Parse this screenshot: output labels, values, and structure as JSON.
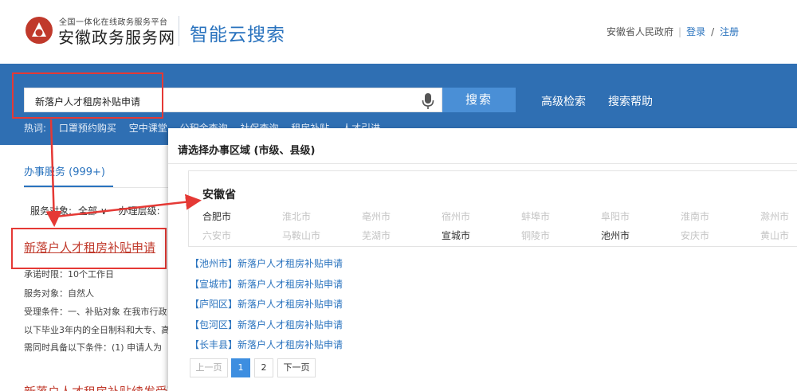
{
  "header": {
    "logo_small": "全国一体化在线政务服务平台",
    "logo_big": "安徽政务服务网",
    "site_title": "智能云搜索",
    "gov_link": "安徽省人民政府",
    "login": "登录",
    "slash": "/",
    "register": "注册"
  },
  "search": {
    "query": "新落户人才租房补贴申请",
    "button": "搜索",
    "advanced": "高级检索",
    "help": "搜索帮助"
  },
  "hotwords": {
    "label": "热词:",
    "items": [
      "口罩预约购买",
      "空中课堂",
      "公积金查询",
      "社保查询",
      "租房补贴",
      "人才引进"
    ]
  },
  "results": {
    "tab": "办事服务 (999+)",
    "filter_label": "服务对象:",
    "filter_value": "全部 ∨",
    "level_label": "办理层级:",
    "first_title": "新落户人才租房补贴申请",
    "info": [
      "承诺时限：10个工作日",
      "服务对象：自然人",
      "受理条件：一、补贴对象 在我市行政",
      "以下毕业3年内的全日制科和大专、高",
      "需同时具备以下条件：(1) 申请人为"
    ],
    "second_title": "新落户人才租房补贴续发受理"
  },
  "modal": {
    "title": "请选择办事区域 (市级、县级)",
    "province": "安徽省",
    "cities_row1": [
      {
        "name": "合肥市",
        "enabled": true
      },
      {
        "name": "淮北市",
        "enabled": false
      },
      {
        "name": "亳州市",
        "enabled": false
      },
      {
        "name": "宿州市",
        "enabled": false
      },
      {
        "name": "蚌埠市",
        "enabled": false
      },
      {
        "name": "阜阳市",
        "enabled": false
      },
      {
        "name": "淮南市",
        "enabled": false
      },
      {
        "name": "滁州市",
        "enabled": false
      }
    ],
    "cities_row2": [
      {
        "name": "六安市",
        "enabled": false
      },
      {
        "name": "马鞍山市",
        "enabled": false
      },
      {
        "name": "芜湖市",
        "enabled": false
      },
      {
        "name": "宣城市",
        "enabled": true
      },
      {
        "name": "铜陵市",
        "enabled": false
      },
      {
        "name": "池州市",
        "enabled": true
      },
      {
        "name": "安庆市",
        "enabled": false
      },
      {
        "name": "黄山市",
        "enabled": false
      }
    ],
    "links": [
      "【池州市】新落户人才租房补贴申请",
      "【宣城市】新落户人才租房补贴申请",
      "【庐阳区】新落户人才租房补贴申请",
      "【包河区】新落户人才租房补贴申请",
      "【长丰县】新落户人才租房补贴申请"
    ],
    "pager": {
      "prev": "上一页",
      "p1": "1",
      "p2": "2",
      "next": "下一页"
    }
  },
  "colors": {
    "brand_blue": "#2f6fb3",
    "accent_red": "#e53935",
    "link_blue": "#2a73be"
  }
}
